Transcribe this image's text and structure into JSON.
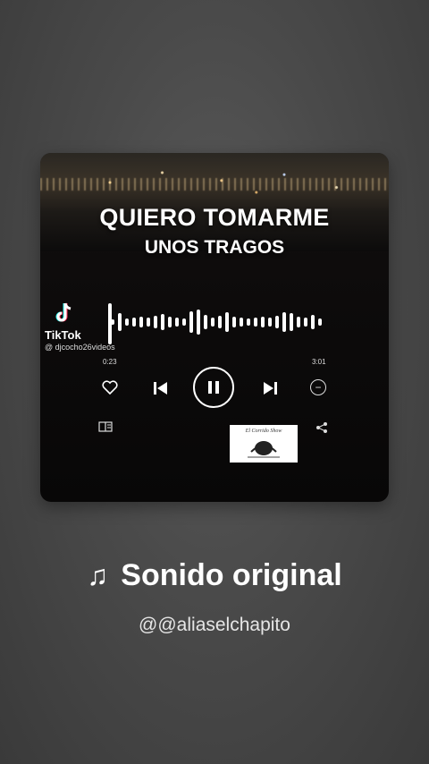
{
  "card": {
    "title_line1": "QUIERO TOMARME",
    "title_line2": "UNOS TRAGOS",
    "watermark": {
      "brand": "TikTok",
      "handle": "@ djcocho26videos"
    },
    "player": {
      "current_time": "0:23",
      "total_time": "3:01",
      "progress": 0.13,
      "icons": [
        "heart-icon",
        "previous-icon",
        "pause-icon",
        "next-icon",
        "minus-circle-icon",
        "queue-icon",
        "share-icon"
      ]
    },
    "stamp_text": "El Corrido Show"
  },
  "song": {
    "icon": "music-note-icon",
    "title": "Sonido original",
    "artist": "@@aliaselchapito"
  },
  "colors": {
    "background": "#4a4a4a",
    "card": "#0e0c0c",
    "text": "#ffffff"
  }
}
